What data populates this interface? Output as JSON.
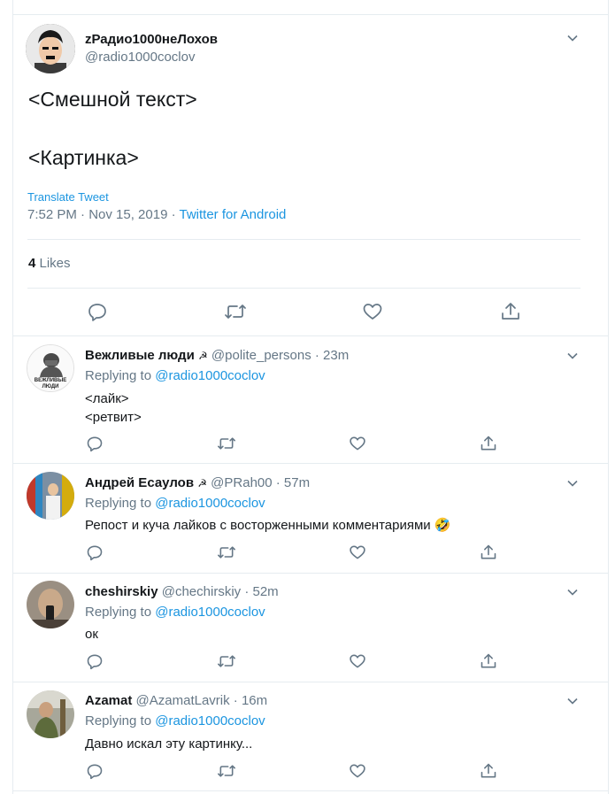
{
  "main_tweet": {
    "name": "zРадио1000неЛохов",
    "handle": "@radio1000coclov",
    "text_line1": "<Смешной текст>",
    "text_line2": "<Картинка>",
    "translate": "Translate Tweet",
    "timestamp": "7:52 PM · Nov 15, 2019 · ",
    "source": "Twitter for Android",
    "likes_count": "4",
    "likes_label": " Likes"
  },
  "replies": [
    {
      "name": "Вежливые люди",
      "emoji": "☭",
      "handle": "@polite_persons",
      "time": " · 23m",
      "replying_label": "Replying to ",
      "replying_to": "@radio1000coclov",
      "lines": [
        "<лайк>",
        "<ретвит>"
      ],
      "avatar_text": "ВЕЖЛИВЫЕ ЛЮДИ"
    },
    {
      "name": "Андрей Есаулов",
      "emoji": "☭",
      "handle": "@PRah00",
      "time": " · 57m",
      "replying_label": "Replying to ",
      "replying_to": "@radio1000coclov",
      "lines": [
        "Репост и куча лайков с восторженными комментариями 🤣"
      ]
    },
    {
      "name": "cheshirskiy",
      "handle": "@chechirskiy",
      "time": " · 52m",
      "replying_label": "Replying to ",
      "replying_to": "@radio1000coclov",
      "lines": [
        "ок"
      ]
    },
    {
      "name": "Azamat",
      "handle": "@AzamatLavrik",
      "time": " · 16m",
      "replying_label": "Replying to ",
      "replying_to": "@radio1000coclov",
      "lines": [
        "Давно искал эту картинку..."
      ]
    }
  ],
  "colors": {
    "link": "#1b95e0",
    "muted": "#657786",
    "text": "#14171a",
    "border": "#e6ecf0"
  },
  "icons": [
    "reply-icon",
    "retweet-icon",
    "like-icon",
    "share-icon",
    "chevron-down-icon"
  ]
}
